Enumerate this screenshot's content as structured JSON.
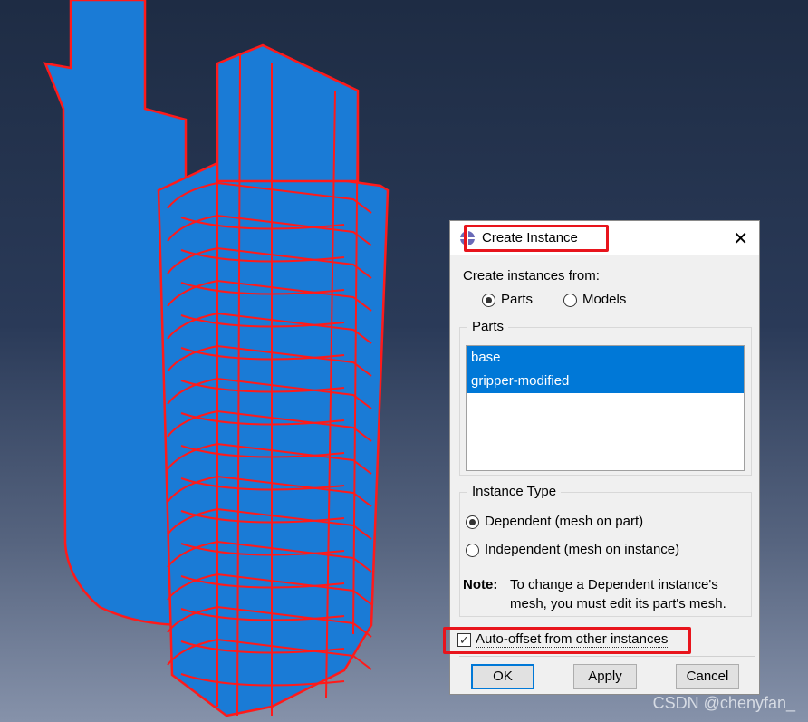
{
  "dialog": {
    "title": "Create Instance",
    "close_icon": "close-icon",
    "create_from_label": "Create instances from:",
    "source_options": [
      {
        "label": "Parts",
        "selected": true
      },
      {
        "label": "Models",
        "selected": false
      }
    ],
    "parts_group": {
      "label": "Parts",
      "items": [
        {
          "label": "base",
          "selected": true
        },
        {
          "label": "gripper-modified",
          "selected": true
        }
      ]
    },
    "instance_type": {
      "label": "Instance Type",
      "options": [
        {
          "label": "Dependent (mesh on part)",
          "selected": true
        },
        {
          "label": "Independent (mesh on instance)",
          "selected": false
        }
      ],
      "note_label": "Note:",
      "note_line1": "To change a Dependent instance's",
      "note_line2": "mesh, you must edit its part's mesh."
    },
    "auto_offset": {
      "label": "Auto-offset from other instances",
      "checked": true
    },
    "buttons": {
      "ok": "OK",
      "apply": "Apply",
      "cancel": "Cancel"
    }
  },
  "watermark": "CSDN @chenyfan_",
  "colors": {
    "highlight": "#e8141c",
    "model": "#1a7bd6",
    "selection": "#0078d7"
  }
}
